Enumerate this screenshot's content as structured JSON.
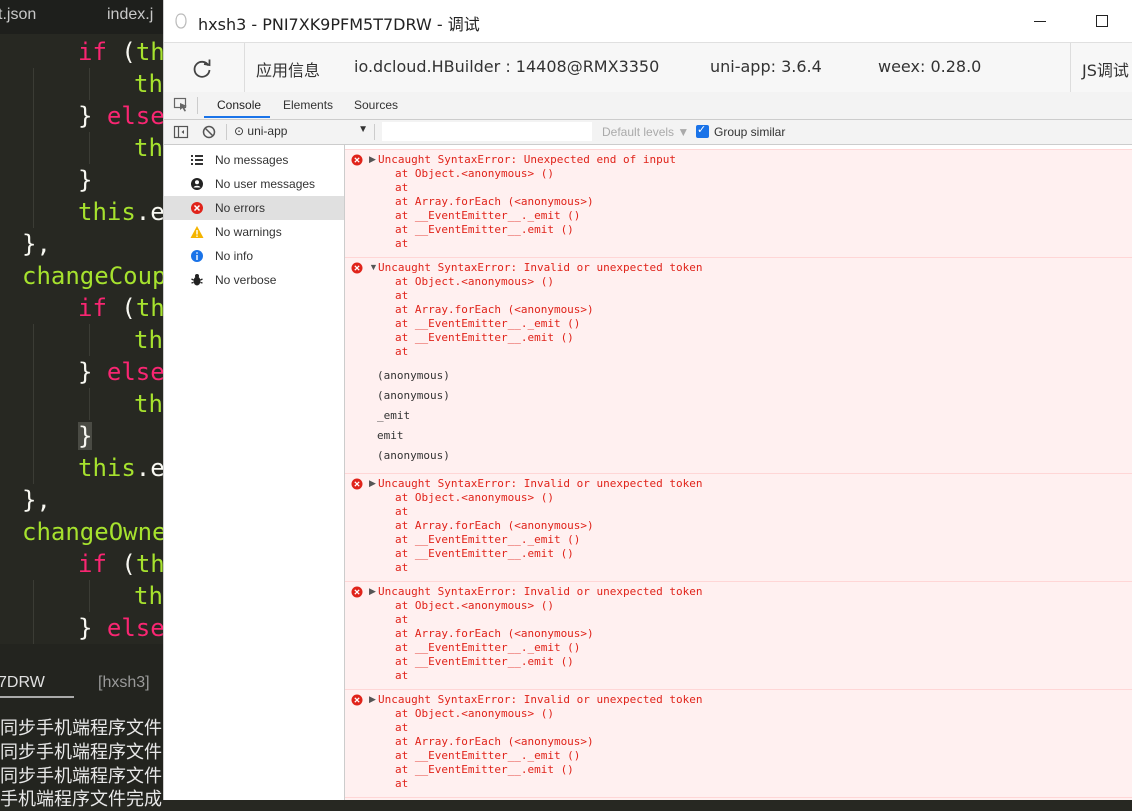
{
  "editor": {
    "tabs": [
      "t.json",
      "index.j"
    ],
    "code_lines": [
      {
        "parts": [
          [
            "if",
            "k"
          ],
          [
            " (",
            "w"
          ],
          [
            "th",
            "f"
          ]
        ],
        "indent": 78
      },
      {
        "parts": [
          [
            "th",
            "f"
          ]
        ],
        "indent": 134
      },
      {
        "parts": [
          [
            "} ",
            "w"
          ],
          [
            "else",
            "k"
          ]
        ],
        "indent": 78
      },
      {
        "parts": [
          [
            "th",
            "f"
          ]
        ],
        "indent": 134
      },
      {
        "parts": [
          [
            "}",
            "w"
          ]
        ],
        "indent": 78
      },
      {
        "parts": [
          [
            "this",
            "f"
          ],
          [
            ".e",
            "w"
          ]
        ],
        "indent": 78
      },
      {
        "parts": [
          [
            "},",
            "w"
          ]
        ],
        "indent": 22
      },
      {
        "parts": [
          [
            "changeCoup",
            "f"
          ]
        ],
        "indent": 22
      },
      {
        "parts": [
          [
            "if",
            "k"
          ],
          [
            " (",
            "w"
          ],
          [
            "th",
            "f"
          ]
        ],
        "indent": 78
      },
      {
        "parts": [
          [
            "th",
            "f"
          ]
        ],
        "indent": 134
      },
      {
        "parts": [
          [
            "} ",
            "w"
          ],
          [
            "else",
            "k"
          ]
        ],
        "indent": 78
      },
      {
        "parts": [
          [
            "th",
            "f"
          ]
        ],
        "indent": 134
      },
      {
        "parts": [
          [
            "}",
            "w"
          ]
        ],
        "indent": 78
      },
      {
        "parts": [
          [
            "this",
            "f"
          ],
          [
            ".e",
            "w"
          ]
        ],
        "indent": 78
      },
      {
        "parts": [
          [
            "},",
            "w"
          ]
        ],
        "indent": 22
      },
      {
        "parts": [
          [
            "changeOwne",
            "f"
          ]
        ],
        "indent": 22
      },
      {
        "parts": [
          [
            "if",
            "k"
          ],
          [
            " (",
            "w"
          ],
          [
            "th",
            "f"
          ]
        ],
        "indent": 78
      },
      {
        "parts": [
          [
            "th",
            "f"
          ]
        ],
        "indent": 134
      },
      {
        "parts": [
          [
            "} ",
            "w"
          ],
          [
            "else",
            "k"
          ]
        ],
        "indent": 78
      }
    ],
    "panel_tabs": [
      "7DRW",
      "[hxsh3]"
    ],
    "output_lines": [
      "同步手机端程序文件",
      "同步手机端程序文件",
      "同步手机端程序文件",
      "手机端程序文件完成"
    ]
  },
  "window": {
    "title": "hxsh3 - PNI7XK9PFM5T7DRW - 调试",
    "info": {
      "label": "应用信息",
      "hbuilder": "io.dcloud.HBuilder : 14408@RMX3350",
      "uniapp": "uni-app: 3.6.4",
      "weex": "weex: 0.28.0",
      "js_debug": "JS调试"
    },
    "devtools_tabs": [
      "Console",
      "Elements",
      "Sources"
    ],
    "toolbar": {
      "context": "⊙ uni-app",
      "filter_placeholder": "",
      "levels": "Default levels ▼",
      "group_similar": "Group similar"
    },
    "sidebar": [
      {
        "label": "No messages",
        "icon": "list-icon"
      },
      {
        "label": "No user messages",
        "icon": "user-icon"
      },
      {
        "label": "No errors",
        "icon": "error-icon",
        "selected": true
      },
      {
        "label": "No warnings",
        "icon": "warning-icon"
      },
      {
        "label": "No info",
        "icon": "info-icon"
      },
      {
        "label": "No verbose",
        "icon": "bug-icon"
      }
    ],
    "messages": [
      {
        "text": "Uncaught SyntaxError: Unexpected end of input",
        "expanded": false,
        "stack": [
          "at Object.<anonymous> ()",
          "at",
          "at Array.forEach (<anonymous>)",
          "at __EventEmitter__._emit ()",
          "at __EventEmitter__.emit ()",
          "at"
        ],
        "tree": []
      },
      {
        "text": "Uncaught SyntaxError: Invalid or unexpected token",
        "expanded": true,
        "stack": [
          "at Object.<anonymous> ()",
          "at",
          "at Array.forEach (<anonymous>)",
          "at __EventEmitter__._emit ()",
          "at __EventEmitter__.emit ()",
          "at"
        ],
        "tree": [
          "(anonymous)",
          "(anonymous)",
          "_emit",
          "emit",
          "(anonymous)"
        ]
      },
      {
        "text": "Uncaught SyntaxError: Invalid or unexpected token",
        "expanded": false,
        "stack": [
          "at Object.<anonymous> ()",
          "at",
          "at Array.forEach (<anonymous>)",
          "at __EventEmitter__._emit ()",
          "at __EventEmitter__.emit ()",
          "at"
        ],
        "tree": []
      },
      {
        "text": "Uncaught SyntaxError: Invalid or unexpected token",
        "expanded": false,
        "stack": [
          "at Object.<anonymous> ()",
          "at",
          "at Array.forEach (<anonymous>)",
          "at __EventEmitter__._emit ()",
          "at __EventEmitter__.emit ()",
          "at"
        ],
        "tree": []
      },
      {
        "text": "Uncaught SyntaxError: Invalid or unexpected token",
        "expanded": false,
        "stack": [
          "at Object.<anonymous> ()",
          "at",
          "at Array.forEach (<anonymous>)",
          "at __EventEmitter__._emit ()",
          "at __EventEmitter__.emit ()",
          "at"
        ],
        "tree": []
      },
      {
        "text": "Uncaught SyntaxError: Invalid or unexpected token",
        "expanded": false,
        "stack": [
          "at Object.<anonymous> ()"
        ],
        "tree": []
      }
    ]
  },
  "colors": {
    "error": "#e0231a",
    "error_bg": "#fff0f0",
    "accent": "#1a73e8"
  }
}
